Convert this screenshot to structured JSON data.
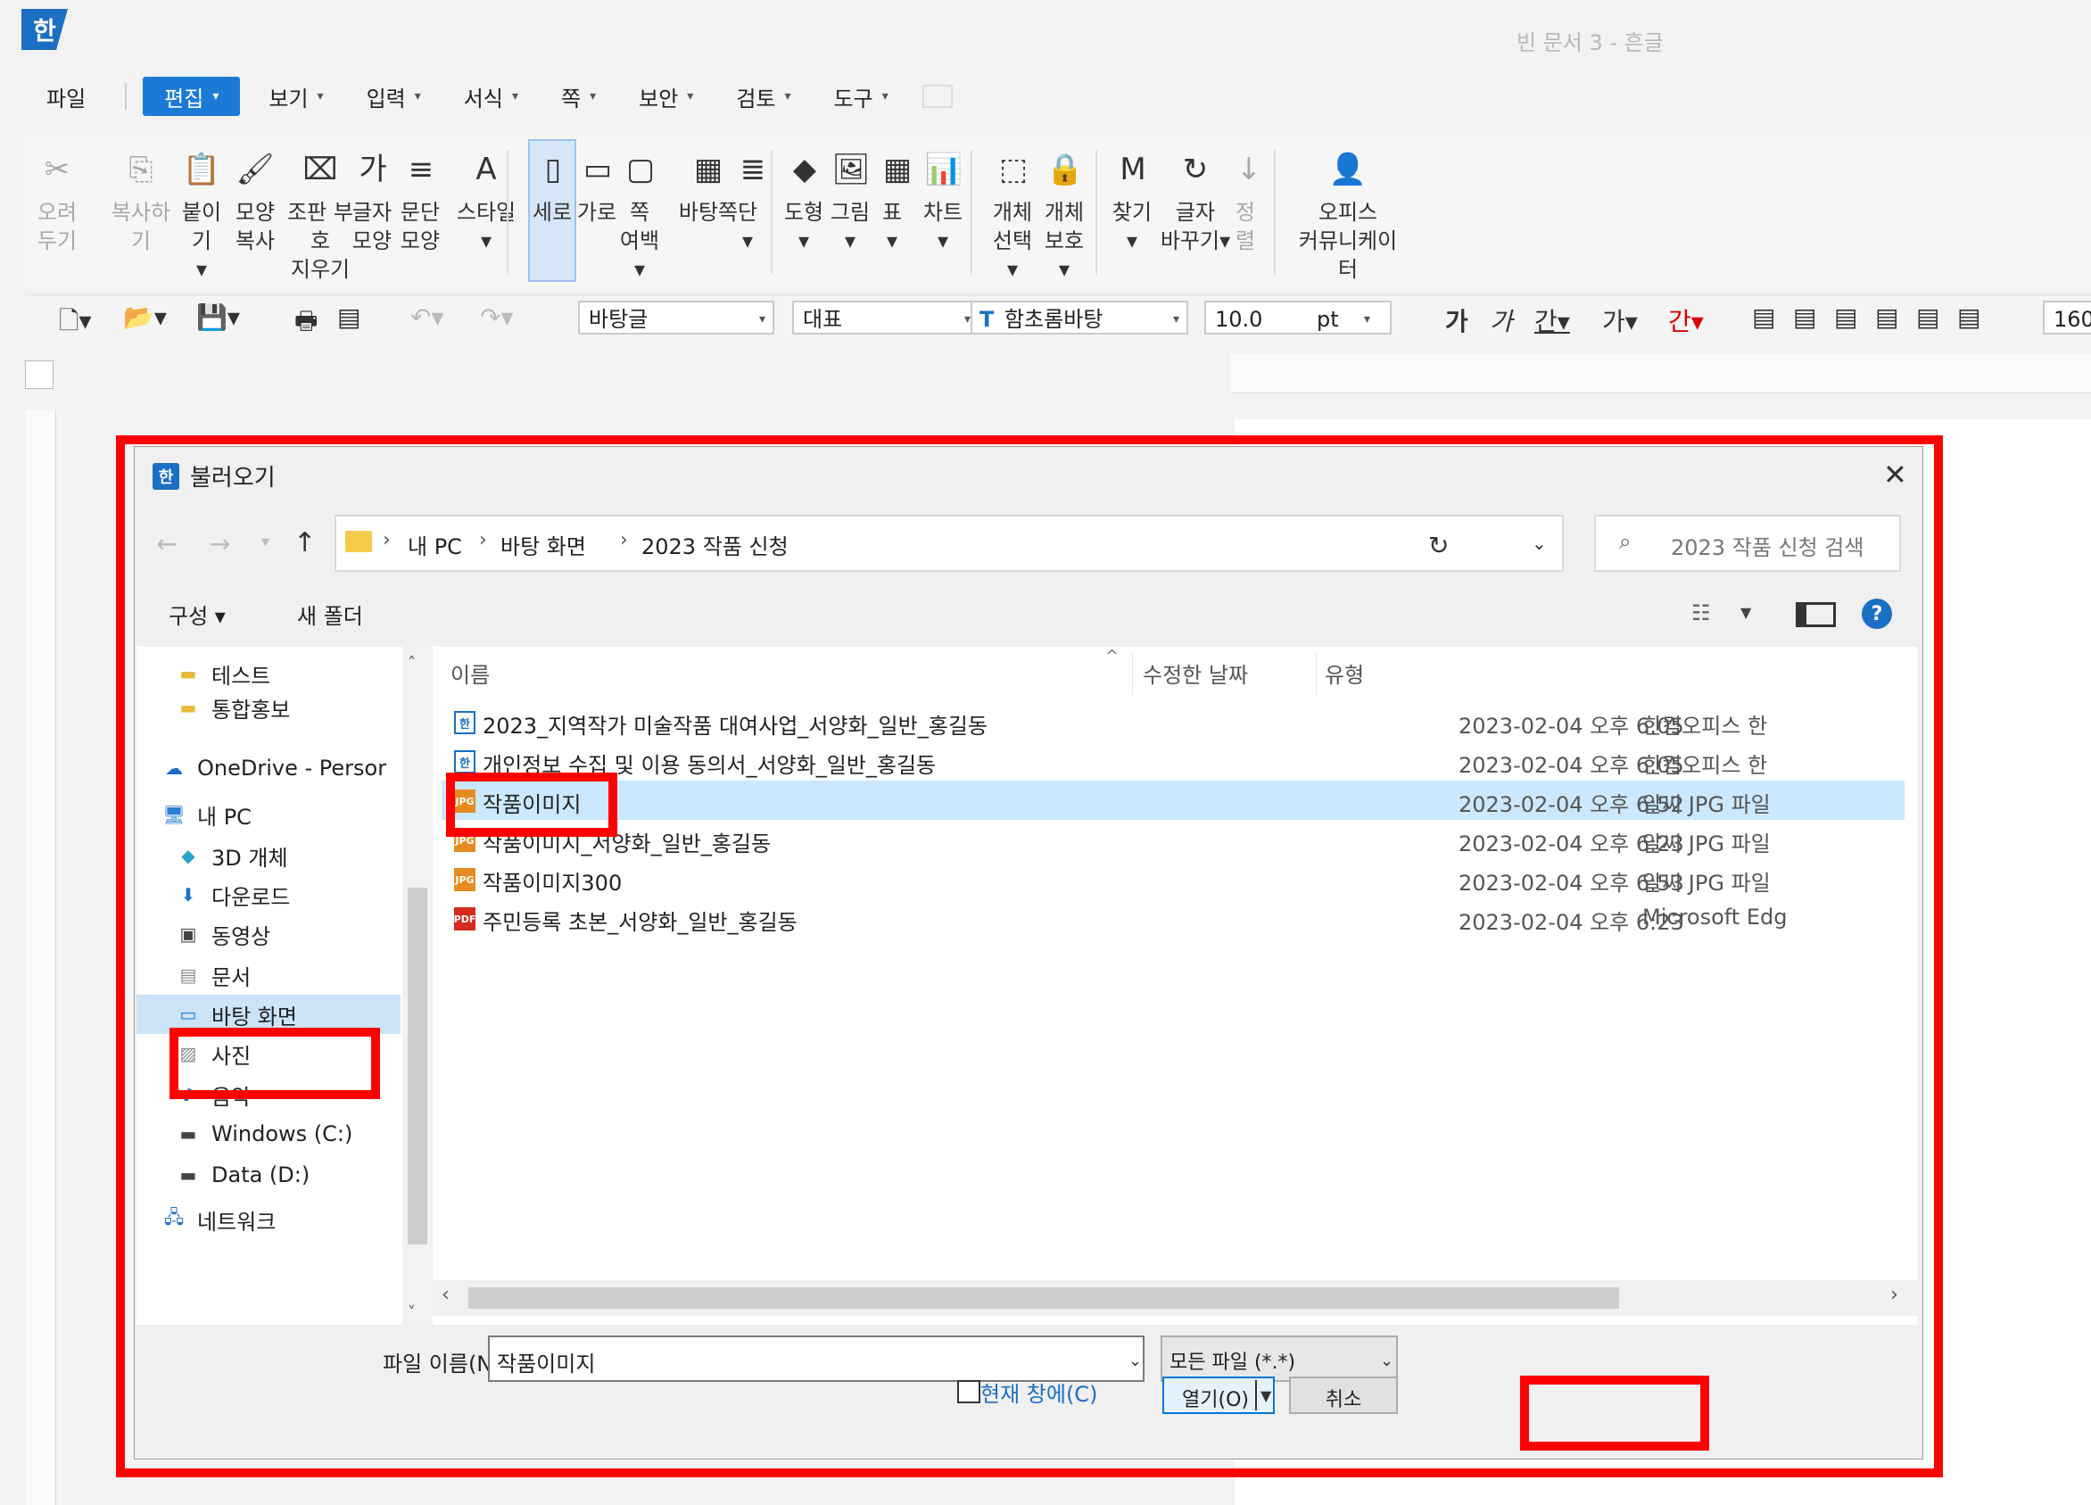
{
  "app": {
    "logo": "한",
    "window_title": "빈 문서 3 - 흔글"
  },
  "menus": [
    {
      "label": "파일",
      "caret": ""
    },
    {
      "label": "편집",
      "caret": "▾"
    },
    {
      "label": "보기",
      "caret": "▾"
    },
    {
      "label": "입력",
      "caret": "▾"
    },
    {
      "label": "서식",
      "caret": "▾"
    },
    {
      "label": "쪽",
      "caret": "▾"
    },
    {
      "label": "보안",
      "caret": "▾"
    },
    {
      "label": "검토",
      "caret": "▾"
    },
    {
      "label": "도구",
      "caret": "▾"
    }
  ],
  "ribbon": [
    {
      "l1": "오려",
      "l2": "두기",
      "icon": "cut-icon"
    },
    {
      "l1": "복사하기",
      "l2": "",
      "icon": "copy-icon"
    },
    {
      "l1": "붙이기",
      "l2": "▾",
      "icon": "paste-icon"
    },
    {
      "l1": "모양",
      "l2": "복사",
      "icon": "format-painter-icon"
    },
    {
      "l1": "조판 부호",
      "l2": "지우기",
      "icon": "clear-marks-icon"
    },
    {
      "l1": "글자",
      "l2": "모양",
      "icon": "char-shape-icon"
    },
    {
      "l1": "문단",
      "l2": "모양",
      "icon": "para-shape-icon"
    },
    {
      "l1": "스타일",
      "l2": "▾",
      "icon": "style-icon"
    },
    {
      "l1": "세로",
      "l2": "",
      "icon": "portrait-icon"
    },
    {
      "l1": "가로",
      "l2": "",
      "icon": "landscape-icon"
    },
    {
      "l1": "쪽",
      "l2": "여백▾",
      "icon": "margin-icon"
    },
    {
      "l1": "바탕쪽",
      "l2": "",
      "icon": "master-page-icon"
    },
    {
      "l1": "단",
      "l2": "▾",
      "icon": "columns-icon"
    },
    {
      "l1": "도형",
      "l2": "▾",
      "icon": "shape-icon"
    },
    {
      "l1": "그림",
      "l2": "▾",
      "icon": "picture-icon"
    },
    {
      "l1": "표",
      "l2": "▾",
      "icon": "table-icon"
    },
    {
      "l1": "차트",
      "l2": "▾",
      "icon": "chart-icon"
    },
    {
      "l1": "개체",
      "l2": "선택▾",
      "icon": "select-object-icon"
    },
    {
      "l1": "개체",
      "l2": "보호▾",
      "icon": "protect-object-icon"
    },
    {
      "l1": "찾기",
      "l2": "▾",
      "icon": "find-icon"
    },
    {
      "l1": "글자",
      "l2": "바꾸기▾",
      "icon": "replace-icon"
    },
    {
      "l1": "정렬",
      "l2": "",
      "icon": "sort-icon"
    },
    {
      "l1": "오피스",
      "l2": "커뮤니케이터",
      "icon": "communicator-icon"
    }
  ],
  "toolbar": {
    "style": "바탕글",
    "lang": "대표",
    "font": "함초롬바탕",
    "size": "10.0",
    "unit": "pt",
    "zoom": "160"
  },
  "dialog": {
    "icon": "한",
    "title": "불러오기",
    "breadcrumb": [
      "내 PC",
      "바탕 화면",
      "2023 작품 신청"
    ],
    "search_placeholder": "2023 작품 신청 검색",
    "organize": "구성 ▾",
    "new_folder": "새 폴더",
    "nav_items": [
      {
        "label": "테스트",
        "icon": "folder-icon"
      },
      {
        "label": "통합홍보",
        "icon": "folder-icon"
      },
      {
        "label": "OneDrive - Persor",
        "icon": "cloud-icon"
      },
      {
        "label": "내 PC",
        "icon": "computer-icon"
      },
      {
        "label": "3D 개체",
        "icon": "cube-icon"
      },
      {
        "label": "다운로드",
        "icon": "download-icon"
      },
      {
        "label": "동영상",
        "icon": "video-icon"
      },
      {
        "label": "문서",
        "icon": "document-icon"
      },
      {
        "label": "바탕 화면",
        "icon": "desktop-icon"
      },
      {
        "label": "사진",
        "icon": "pictures-icon"
      },
      {
        "label": "음악",
        "icon": "music-icon"
      },
      {
        "label": "Windows (C:)",
        "icon": "drive-icon"
      },
      {
        "label": "Data (D:)",
        "icon": "drive-icon"
      },
      {
        "label": "네트워크",
        "icon": "network-icon"
      }
    ],
    "columns": {
      "name": "이름",
      "date": "수정한 날짜",
      "type": "유형"
    },
    "files": [
      {
        "name": "2023_지역작가 미술작품 대여사업_서양화_일반_홍길동",
        "date": "2023-02-04 오후 6:05",
        "type": "한컴오피스 한",
        "kind": "hwp",
        "badge": "한"
      },
      {
        "name": "개인정보 수집 및 이용 동의서_서양화_일반_홍길동",
        "date": "2023-02-04 오후 6:05",
        "type": "한컴오피스 한",
        "kind": "hwp",
        "badge": "한"
      },
      {
        "name": "작품이미지",
        "date": "2023-02-04 오후 6:52",
        "type": "알씨 JPG 파일",
        "kind": "jpg",
        "badge": "JPG"
      },
      {
        "name": "작품이미지_서양화_일반_홍길동",
        "date": "2023-02-04 오후 6:23",
        "type": "알씨 JPG 파일",
        "kind": "jpg",
        "badge": "JPG"
      },
      {
        "name": "작품이미지300",
        "date": "2023-02-04 오후 6:53",
        "type": "알씨 JPG 파일",
        "kind": "jpg",
        "badge": "JPG"
      },
      {
        "name": "주민등록 초본_서양화_일반_홍길동",
        "date": "2023-02-04 오후 6:23",
        "type": "Microsoft Edg",
        "kind": "pdf",
        "badge": "PDF"
      }
    ],
    "filename_label": "파일 이름(N):",
    "filename_value": "작품이미지",
    "filetype_value": "모든 파일 (*.*)",
    "current_window_label": "현재 창에(C)",
    "open_label": "열기(O)",
    "cancel_label": "취소"
  },
  "colors": {
    "accent": "#1b7ad6",
    "highlight": "#ff0000",
    "selection": "#cce8ff"
  }
}
